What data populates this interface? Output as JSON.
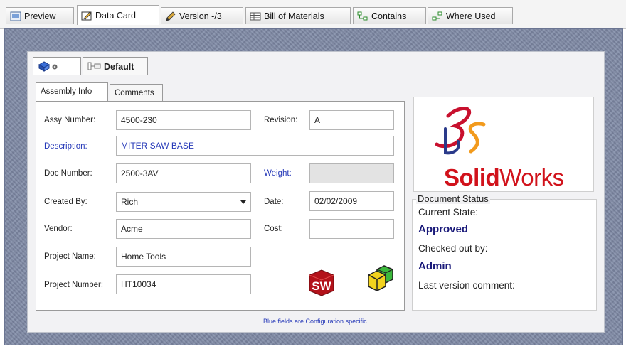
{
  "tabs": [
    {
      "label": "Preview",
      "icon": "preview-icon"
    },
    {
      "label": "Data Card",
      "icon": "data-card-icon",
      "active": true
    },
    {
      "label": "Version -/3",
      "icon": "pencil-icon"
    },
    {
      "label": "Bill of Materials",
      "icon": "table-icon"
    },
    {
      "label": "Contains",
      "icon": "tree-contains-icon"
    },
    {
      "label": "Where Used",
      "icon": "tree-where-used-icon"
    }
  ],
  "config": {
    "tab1_icon": "assembly-icon",
    "tab2_label": "Default"
  },
  "inner_tabs": [
    "Assembly Info",
    "Comments"
  ],
  "form": {
    "assy_number": {
      "label": "Assy Number:",
      "value": "4500-230"
    },
    "revision": {
      "label": "Revision:",
      "value": "A"
    },
    "description": {
      "label": "Description:",
      "value": "MITER SAW BASE"
    },
    "doc_number": {
      "label": "Doc Number:",
      "value": "2500-3AV"
    },
    "weight": {
      "label": "Weight:",
      "value": ""
    },
    "created_by": {
      "label": "Created By:",
      "value": "Rich"
    },
    "date": {
      "label": "Date:",
      "value": "02/02/2009"
    },
    "vendor": {
      "label": "Vendor:",
      "value": "Acme"
    },
    "cost": {
      "label": "Cost:",
      "value": ""
    },
    "project_name": {
      "label": "Project Name:",
      "value": "Home Tools"
    },
    "project_number": {
      "label": "Project Number:",
      "value": "HT10034"
    }
  },
  "footnote": "Blue fields are Configuration specific",
  "logo": {
    "bold": "Solid",
    "light": "Works"
  },
  "status": {
    "title": "Document Status",
    "current_state_label": "Current State:",
    "current_state": "Approved",
    "checked_out_label": "Checked out by:",
    "checked_out_by": "Admin",
    "last_comment_label": "Last version comment:"
  },
  "colors": {
    "config_specific": "#2538b8",
    "logo_red": "#d1121b",
    "status_value": "#1a1a7a"
  }
}
